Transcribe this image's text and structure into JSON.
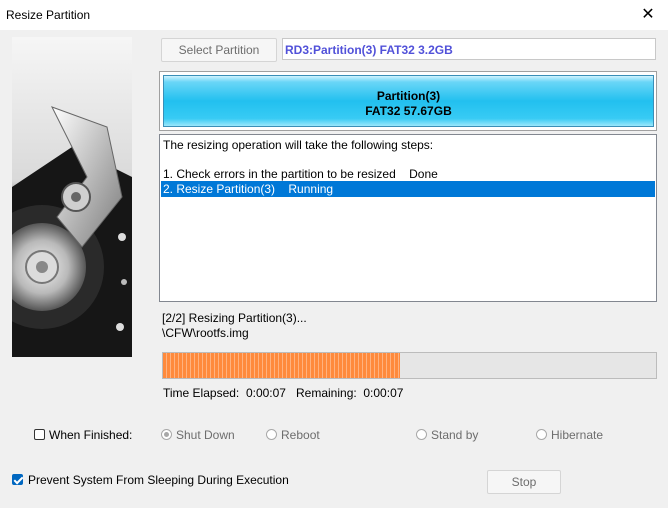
{
  "window": {
    "title": "Resize Partition",
    "close_icon": "close-icon"
  },
  "toolbar": {
    "select_partition_label": "Select Partition",
    "partition_value": "RD3:Partition(3) FAT32 3.2GB"
  },
  "disk_map": {
    "partition_name": "Partition(3)",
    "partition_info": "FAT32 57.67GB",
    "color": "#22c0ef"
  },
  "steps": {
    "header": "The resizing operation will take the following steps:",
    "items": [
      {
        "label": "1. Check errors in the partition to be resized",
        "status": "Done"
      },
      {
        "label": "2. Resize Partition(3)",
        "status": "Running"
      }
    ]
  },
  "progress": {
    "stage_text": "[2/2] Resizing Partition(3)...",
    "current_file": "\\CFW\\rootfs.img",
    "fraction": 0.48,
    "fill_color": "#ff8a3c",
    "elapsed_label": "Time Elapsed:",
    "elapsed_value": "0:00:07",
    "remaining_label": "Remaining:",
    "remaining_value": "0:00:07"
  },
  "when_finished": {
    "label": "When Finished:",
    "checked": false,
    "options": [
      "Shut Down",
      "Reboot",
      "Stand by",
      "Hibernate"
    ],
    "selected": "Shut Down"
  },
  "prevent_sleep": {
    "label": "Prevent System From Sleeping During Execution",
    "checked": true
  },
  "buttons": {
    "stop_label": "Stop"
  }
}
